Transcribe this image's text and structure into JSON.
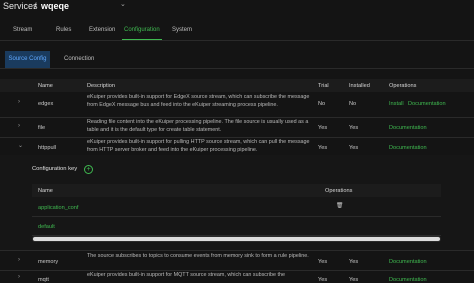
{
  "breadcrumb": {
    "root": "Services",
    "separator": "/",
    "current": "wqeqe"
  },
  "tabs": [
    {
      "label": "Stream"
    },
    {
      "label": "Rules"
    },
    {
      "label": "Extension"
    },
    {
      "label": "Configuration",
      "active": true
    },
    {
      "label": "System"
    }
  ],
  "subtabs": [
    {
      "label": "Source Config",
      "active": true
    },
    {
      "label": "Connection"
    }
  ],
  "table": {
    "headers": {
      "name": "Name",
      "description": "Description",
      "trial": "Trial",
      "installed": "Installed",
      "operations": "Operations"
    },
    "rows": [
      {
        "name": "edgex",
        "description": "eKuiper provides built-in support for EdgeX source stream, which can subscribe the message from EdgeX message bus and feed into the eKuiper streaming process pipeline.",
        "trial": "No",
        "installed": "No",
        "ops": [
          "Install",
          "Documentation"
        ]
      },
      {
        "name": "file",
        "description": "Reading file content into the eKuiper processing pipeline. The file source is usually used as a table and it is the default type for create table statement.",
        "trial": "Yes",
        "installed": "Yes",
        "ops": [
          "Documentation"
        ]
      },
      {
        "name": "httppull",
        "description": "eKuiper provides built-in support for pulling HTTP source stream, which can pull the message from HTTP server broker and feed into the eKuiper processing pipeline.",
        "trial": "Yes",
        "installed": "Yes",
        "ops": [
          "Documentation"
        ]
      },
      {
        "name": "memory",
        "description": "The source subscribes to topics to consume events from memory sink to form a rule pipeline.",
        "trial": "Yes",
        "installed": "Yes",
        "ops": [
          "Documentation"
        ]
      },
      {
        "name": "mqtt",
        "description": "eKuiper provides built-in support for MQTT source stream, which can subscribe the",
        "trial": "Yes",
        "installed": "Yes",
        "ops": [
          "Documentation"
        ]
      }
    ]
  },
  "config": {
    "title": "Configuration key",
    "headers": {
      "name": "Name",
      "operations": "Operations"
    },
    "rows": [
      {
        "name": "application_conf"
      },
      {
        "name": "default"
      }
    ]
  }
}
